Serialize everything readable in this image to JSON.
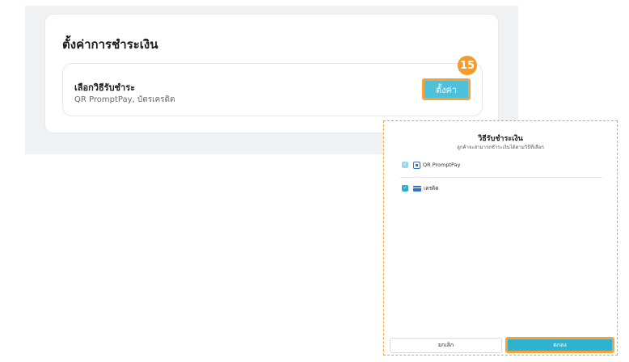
{
  "settings": {
    "title": "ตั้งค่าการชำระเงิน",
    "method_row": {
      "title": "เลือกวิธีรับชำระ",
      "subtitle": "QR PromptPay, บัตรเครดิต"
    },
    "config_button_label": "ตั้งค่า",
    "step_badge": "15"
  },
  "modal": {
    "title": "วิธีรับชำระเงิน",
    "subtitle": "ลูกค้าจะสามารถชำระเงินได้ตามวิธีที่เลือก",
    "options": [
      {
        "label": "QR PromptPay",
        "icon": "qr-icon",
        "checked": true,
        "disabled": true
      },
      {
        "label": "เครดิต",
        "icon": "credit-card-icon",
        "checked": true,
        "disabled": false
      }
    ],
    "cancel_label": "ยกเลิก",
    "ok_label": "ตกลง"
  },
  "colors": {
    "accent": "#2fb2cf",
    "highlight": "#f3a23c",
    "badge": "#f39c2b"
  }
}
